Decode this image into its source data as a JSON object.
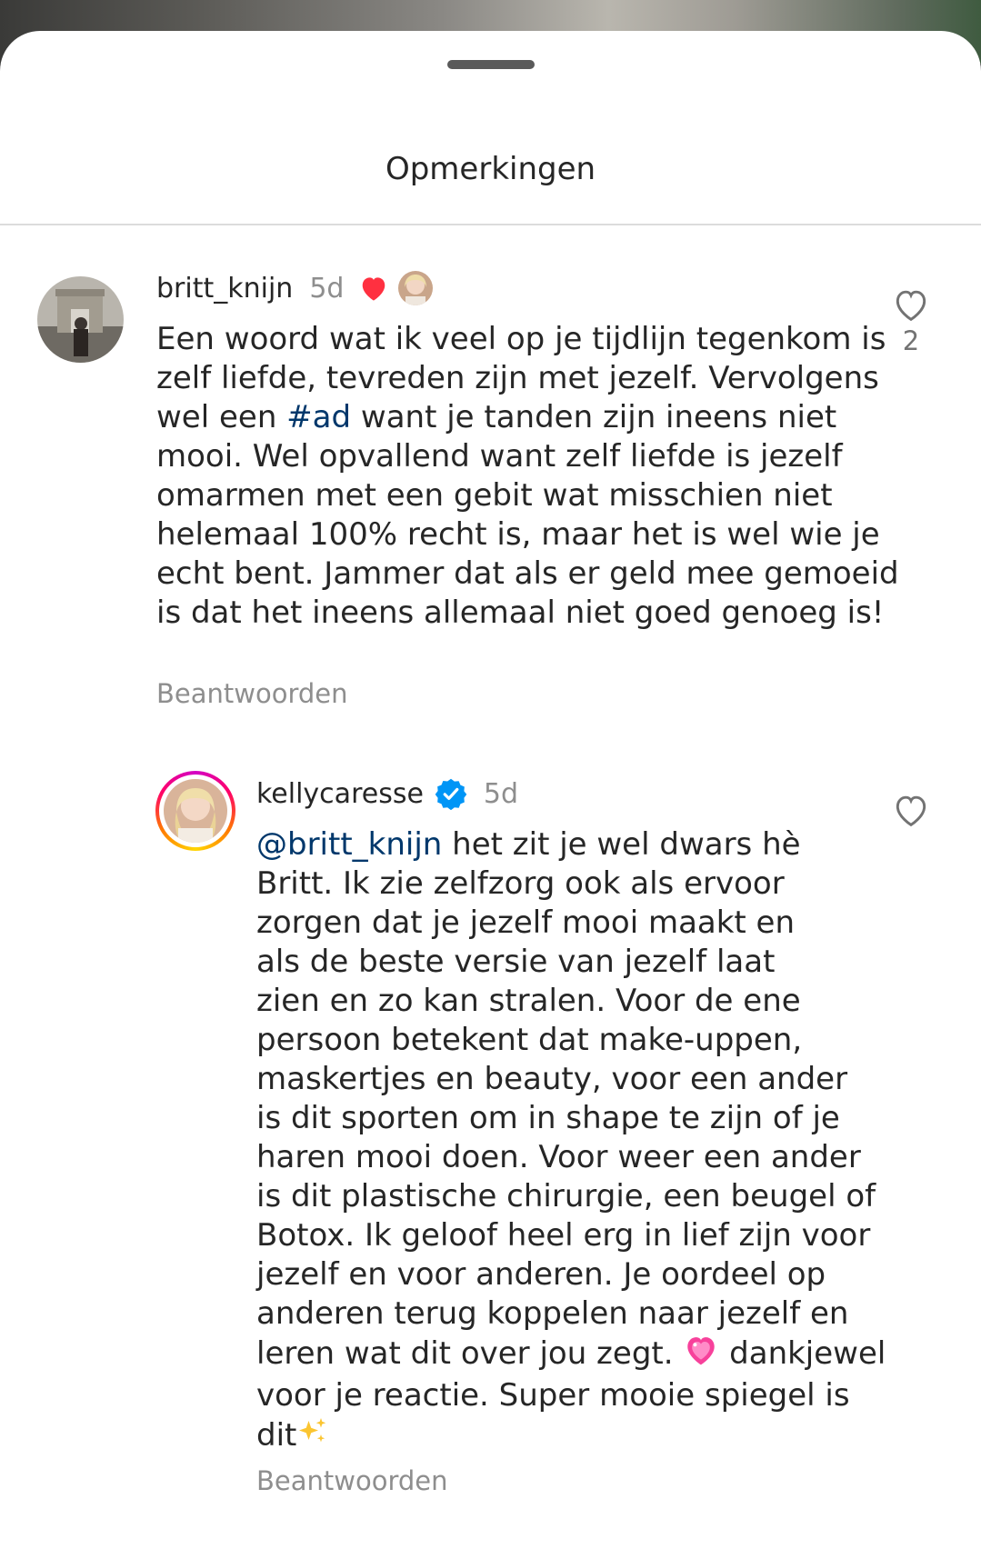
{
  "header": {
    "title": "Opmerkingen"
  },
  "comments": [
    {
      "username": "britt_knijn",
      "time": "5d",
      "liked_by_author": true,
      "text_lines": [
        "Een woord wat ik veel op je tijdlijn tegenkom is",
        "zelf liefde, tevreden zijn met jezelf. Vervolgens",
        "wel een ",
        "#ad",
        " want je tanden zijn ineens niet",
        "mooi. Wel opvallend want zelf liefde is jezelf",
        "omarmen met een gebit wat misschien niet",
        "helemaal 100% recht is, maar het is wel wie je",
        "echt bent. Jammer dat als er geld mee gemoeid",
        "is dat het ineens allemaal niet goed genoeg is!"
      ],
      "reply_label": "Beantwoorden",
      "like_count": "2",
      "icons": {
        "like": "heart-outline-icon",
        "author_like": "red-heart-icon"
      }
    },
    {
      "username": "kellycaresse",
      "verified": true,
      "time": "5d",
      "text_lines": [
        "@britt_knijn",
        " het zit je wel dwars hè",
        "Britt. Ik zie zelfzorg ook als ervoor",
        "zorgen dat je jezelf mooi maakt en",
        "als de beste versie van jezelf laat",
        "zien en zo kan stralen. Voor de ene",
        "persoon betekent dat make-uppen,",
        "maskertjes en beauty, voor een ander",
        "is dit sporten om in shape te zijn of je",
        "haren mooi doen. Voor weer een ander",
        "is dit plastische chirurgie, een beugel of",
        "Botox. Ik geloof heel erg in lief zijn voor",
        "jezelf en voor anderen. Je oordeel op",
        "anderen terug koppelen naar jezelf en",
        "leren wat dit over jou zegt. ",
        " dankjewel",
        "voor je reactie. Super mooie spiegel is",
        "dit"
      ],
      "reply_label": "Beantwoorden",
      "icons": {
        "like": "heart-outline-icon",
        "verified": "verified-badge-icon",
        "emoji_1": "sparkling-heart-emoji",
        "emoji_2": "sparkles-emoji"
      }
    }
  ],
  "colors": {
    "link": "#00376b",
    "muted": "#8e8e8e",
    "heart_red": "#ff3040",
    "verified_blue": "#0095f6"
  }
}
